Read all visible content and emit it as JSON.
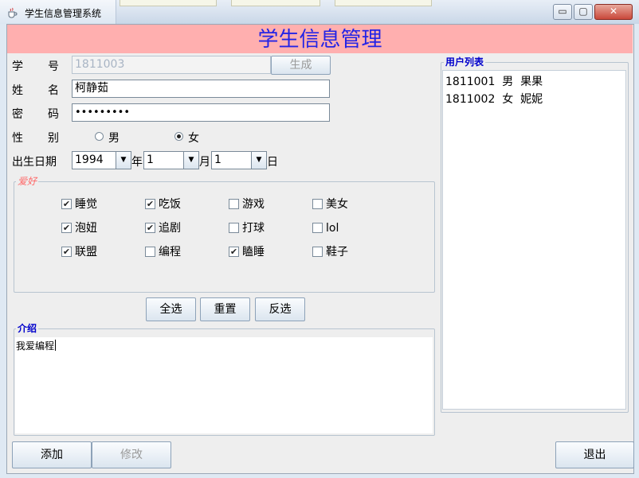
{
  "window": {
    "title": "学生信息管理系统",
    "minimize": "▭",
    "maximize": "▢",
    "close": "✕"
  },
  "header": {
    "title": "学生信息管理"
  },
  "form": {
    "id_label": "学号",
    "id_value": "1811003",
    "generate_btn": "生成",
    "name_label": "姓名",
    "name_value": "柯静茹",
    "password_label": "密码",
    "password_value": "•••••••••",
    "gender_label": "性别",
    "gender_options": [
      {
        "label": "男",
        "selected": false
      },
      {
        "label": "女",
        "selected": true
      }
    ],
    "birth_label": "出生日期",
    "birth_year": "1994",
    "year_unit": "年",
    "birth_month": "1",
    "month_unit": "月",
    "birth_day": "1",
    "day_unit": "日"
  },
  "hobbies": {
    "title": "爱好",
    "items": [
      {
        "label": "睡觉",
        "checked": true
      },
      {
        "label": "吃饭",
        "checked": true
      },
      {
        "label": "游戏",
        "checked": false
      },
      {
        "label": "美女",
        "checked": false
      },
      {
        "label": "泡妞",
        "checked": true
      },
      {
        "label": "追剧",
        "checked": true
      },
      {
        "label": "打球",
        "checked": false
      },
      {
        "label": "lol",
        "checked": false
      },
      {
        "label": "联盟",
        "checked": true
      },
      {
        "label": "编程",
        "checked": false
      },
      {
        "label": "瞌睡",
        "checked": true
      },
      {
        "label": "鞋子",
        "checked": false
      }
    ]
  },
  "hobby_buttons": {
    "select_all": "全选",
    "reset": "重置",
    "invert": "反选"
  },
  "intro": {
    "title": "介绍",
    "text": "我爱编程"
  },
  "userlist": {
    "title": "用户列表",
    "items": [
      "1811001  男  果果",
      "1811002  女  妮妮"
    ]
  },
  "bottom": {
    "add": "添加",
    "edit": "修改",
    "exit": "退出"
  },
  "colors": {
    "header_bg": "#ffafaf",
    "header_text": "#2323e6",
    "group_title": "#0000cc",
    "hobby_title": "#ff6666"
  }
}
